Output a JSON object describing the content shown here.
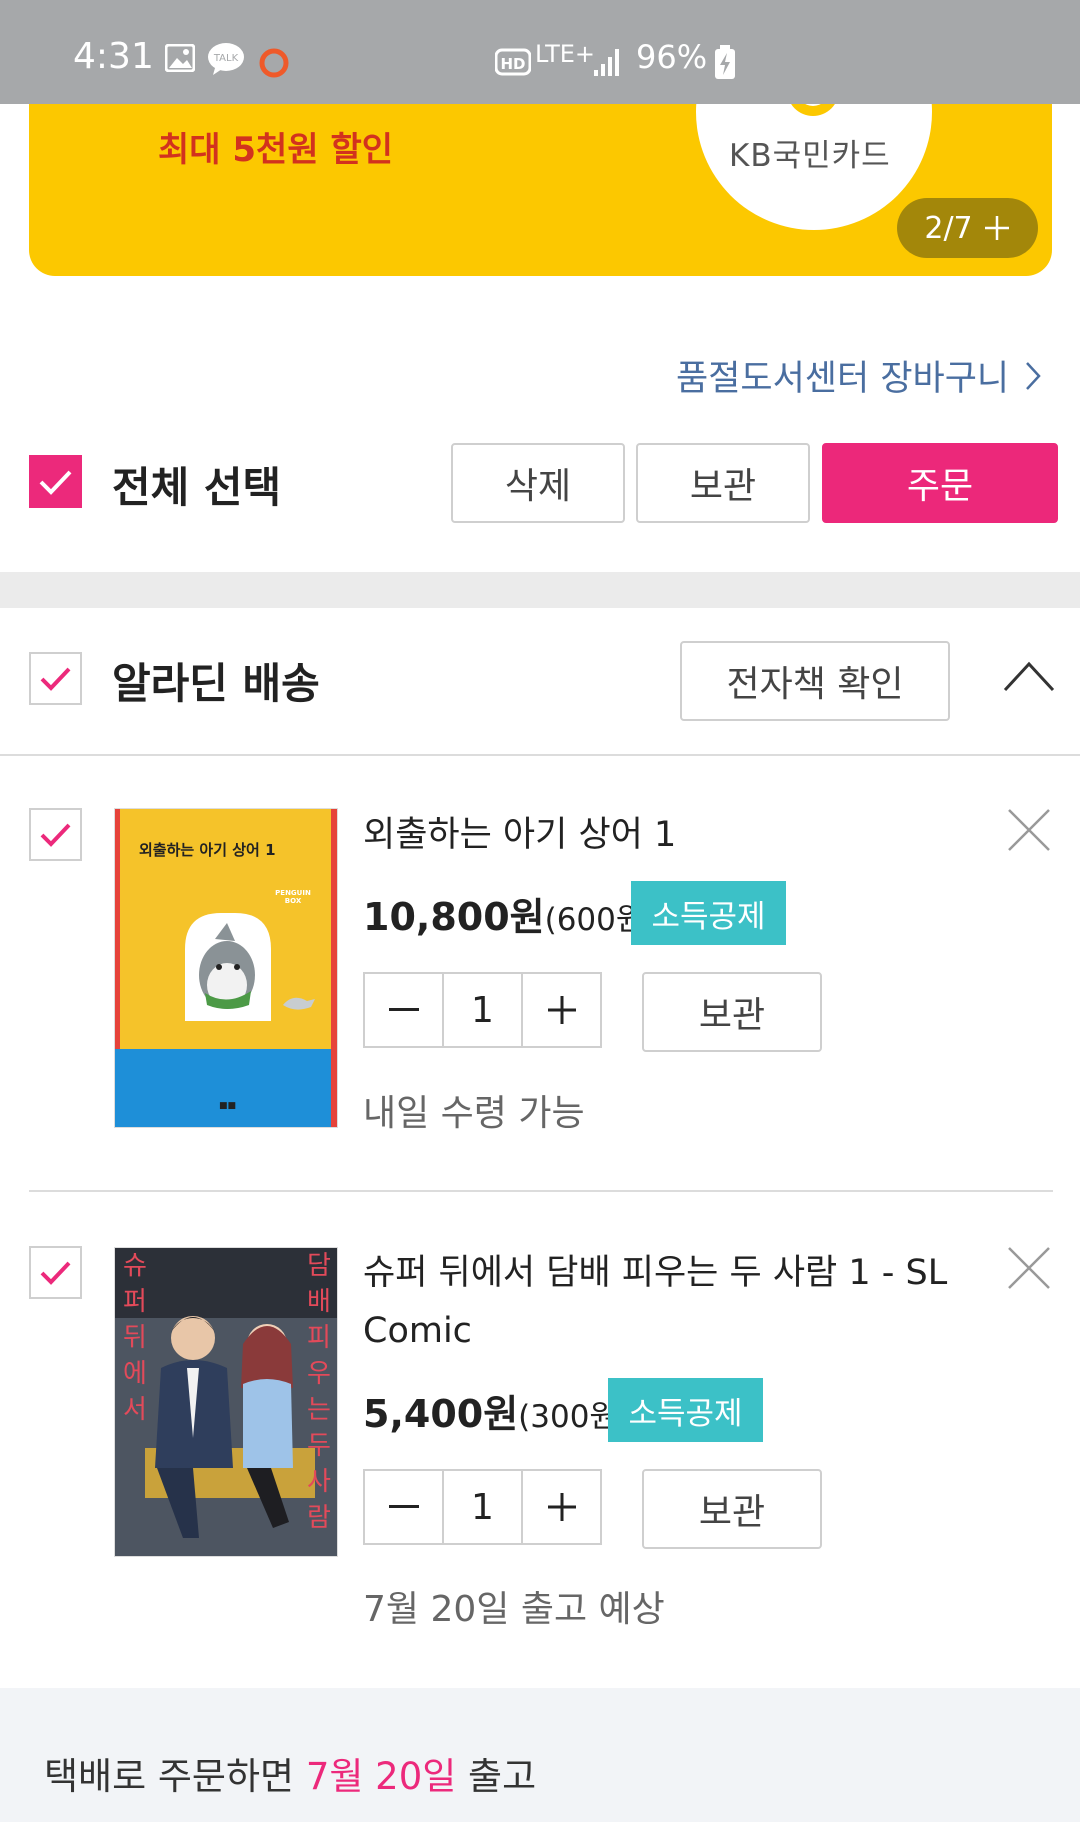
{
  "status_bar": {
    "time": "4:31",
    "network": "LTE+",
    "battery": "96%"
  },
  "banner": {
    "promo_text": "최대 5천원 할인",
    "card_brand": "KB국민카드",
    "pager": "2/7"
  },
  "cart_link": "품절도서센터 장바구니",
  "toolbar": {
    "select_all_label": "전체 선택",
    "delete_label": "삭제",
    "keep_label": "보관",
    "order_label": "주문"
  },
  "section": {
    "title": "알라딘 배송",
    "ebook_check_label": "전자책 확인"
  },
  "items": [
    {
      "title": "외출하는 아기 상어 1",
      "price": "10,800원",
      "points": "(600원)",
      "badge": "소득공제",
      "quantity": "1",
      "keep_label": "보관",
      "note": "내일 수령 가능",
      "cover_title": "외출하는 아기 상어 1",
      "cover_publisher": "PENGUIN BOX"
    },
    {
      "title": "슈퍼 뒤에서 담배 피우는 두 사람 1 - SL Comic",
      "price": "5,400원",
      "points": "(300원)",
      "badge": "소득공제",
      "quantity": "1",
      "keep_label": "보관",
      "note": "7월 20일 출고 예상",
      "cover_title": "슈퍼 뒤에서 담배 피우는 두 사람"
    }
  ],
  "footer": {
    "prefix": "택배로 주문하면 ",
    "date": "7월 20일",
    "suffix": " 출고"
  },
  "colors": {
    "accent": "#ec297b",
    "badge": "#3cc1c7",
    "banner": "#fcc800",
    "status_bar": "#a6a8aa"
  }
}
